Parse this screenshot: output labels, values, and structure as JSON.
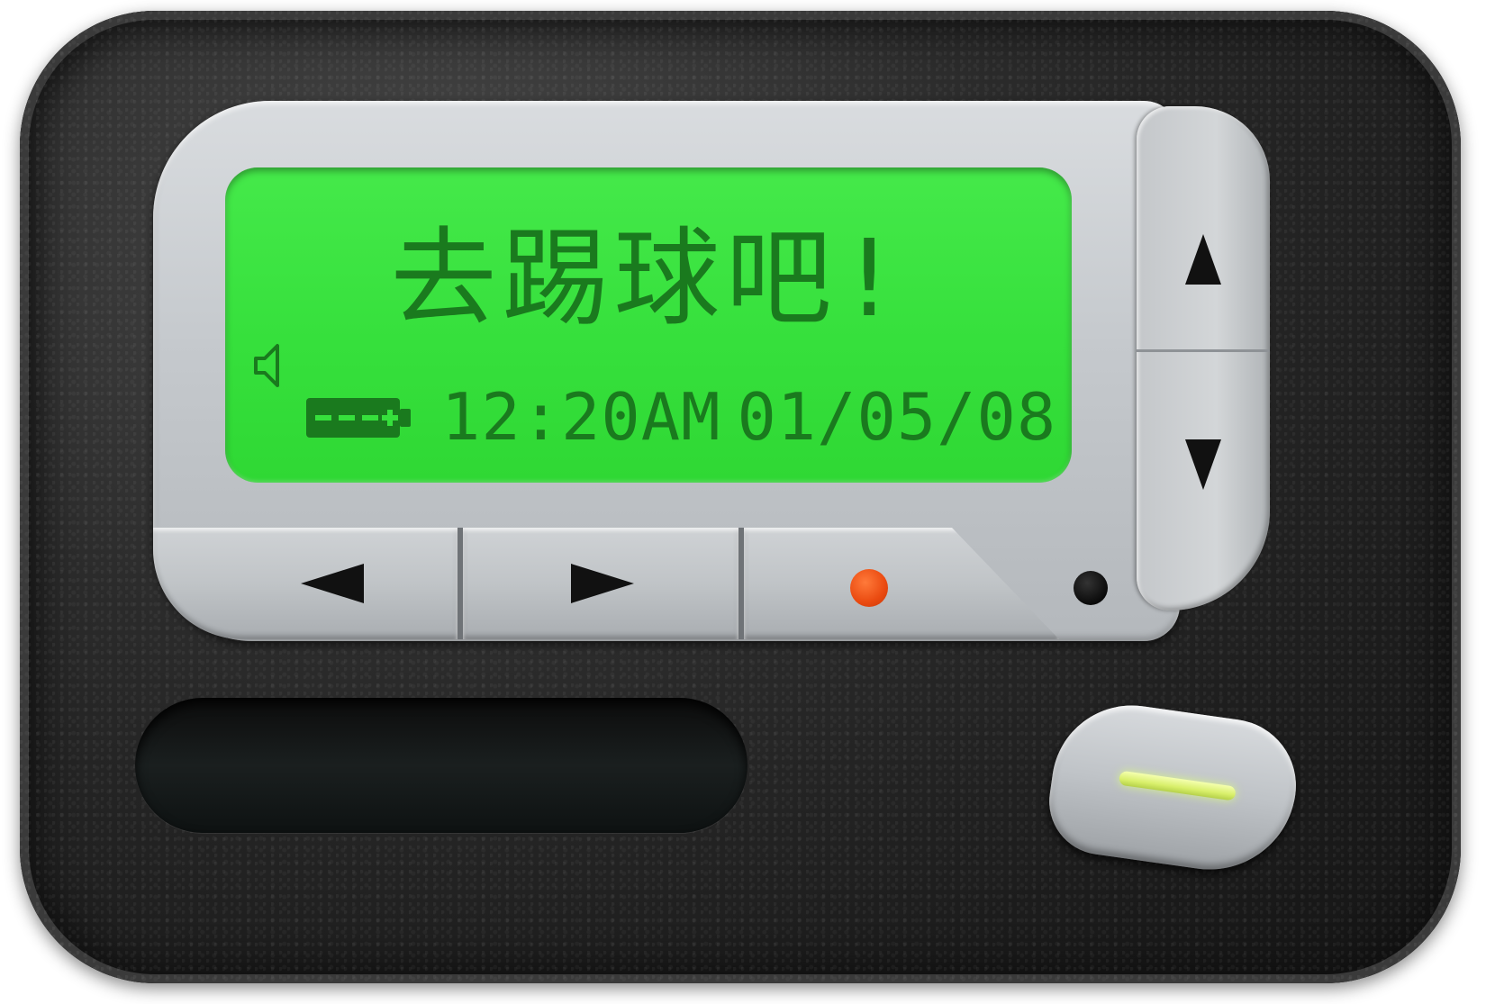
{
  "device": {
    "type": "pager"
  },
  "lcd": {
    "message": "去踢球吧!",
    "time": "12:20AM",
    "date": "01/05/08",
    "battery_level": 0.75
  },
  "icons": {
    "speaker": "speaker-icon",
    "battery": "battery-icon",
    "up": "arrow-up-icon",
    "down": "arrow-down-icon",
    "left": "arrow-left-icon",
    "right": "arrow-right-icon"
  },
  "colors": {
    "lcd_background": "#36e03c",
    "lcd_text": "#1a7a1e",
    "select_dot": "#ea4a10",
    "power_led": "#d8ef6a",
    "body": "#1c1c1c",
    "faceplate": "#c5c9cd"
  }
}
